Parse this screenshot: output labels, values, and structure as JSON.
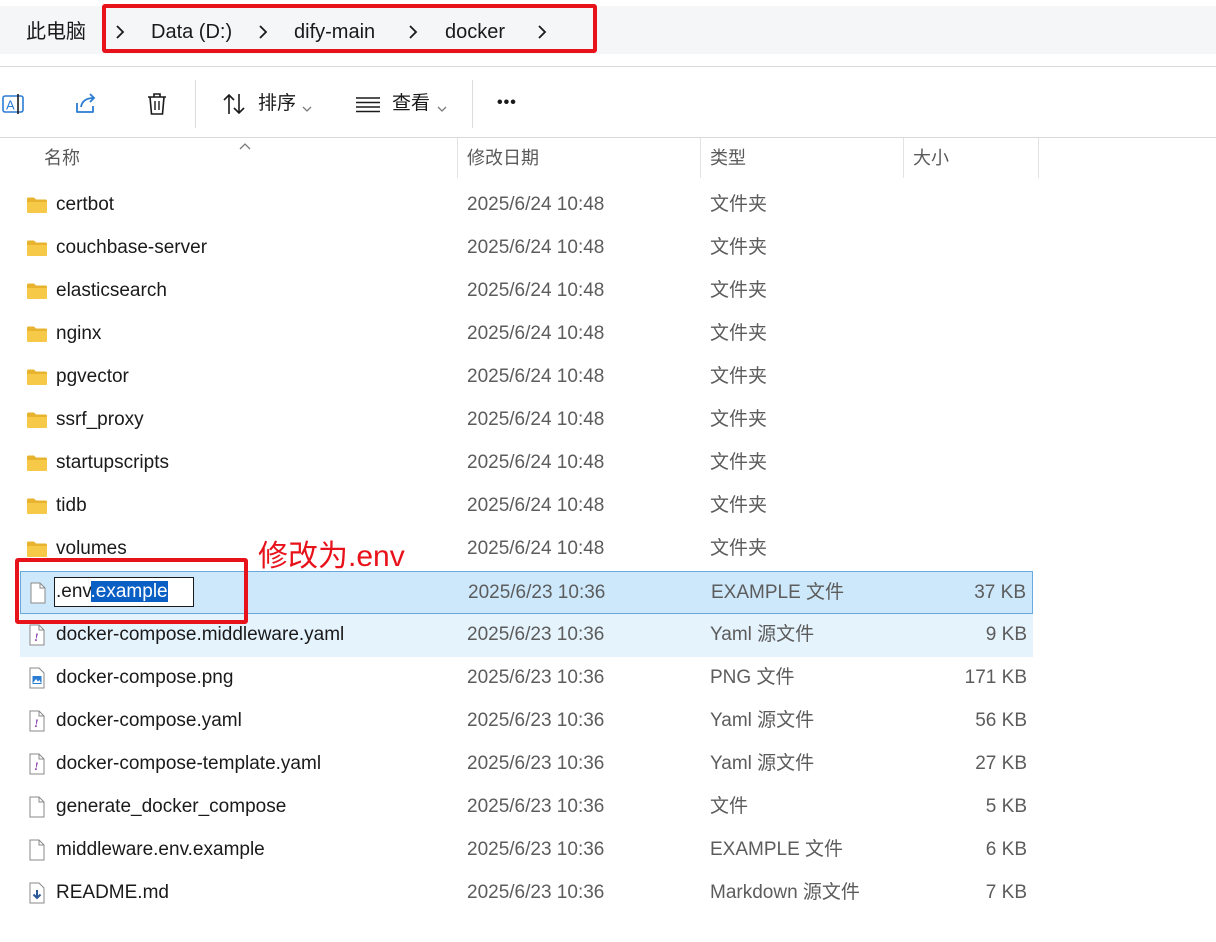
{
  "address": {
    "root": "此电脑",
    "crumbs": [
      "Data (D:)",
      "dify-main",
      "docker"
    ]
  },
  "toolbar": {
    "sort_label": "排序",
    "view_label": "查看",
    "more_label": "•••"
  },
  "columns": {
    "name": "名称",
    "date": "修改日期",
    "type": "类型",
    "size": "大小"
  },
  "files": [
    {
      "name": "certbot",
      "date": "2025/6/24 10:48",
      "type": "文件夹",
      "size": "",
      "icon": "folder-icon"
    },
    {
      "name": "couchbase-server",
      "date": "2025/6/24 10:48",
      "type": "文件夹",
      "size": "",
      "icon": "folder-icon"
    },
    {
      "name": "elasticsearch",
      "date": "2025/6/24 10:48",
      "type": "文件夹",
      "size": "",
      "icon": "folder-icon"
    },
    {
      "name": "nginx",
      "date": "2025/6/24 10:48",
      "type": "文件夹",
      "size": "",
      "icon": "folder-icon"
    },
    {
      "name": "pgvector",
      "date": "2025/6/24 10:48",
      "type": "文件夹",
      "size": "",
      "icon": "folder-icon"
    },
    {
      "name": "ssrf_proxy",
      "date": "2025/6/24 10:48",
      "type": "文件夹",
      "size": "",
      "icon": "folder-icon"
    },
    {
      "name": "startupscripts",
      "date": "2025/6/24 10:48",
      "type": "文件夹",
      "size": "",
      "icon": "folder-icon"
    },
    {
      "name": "tidb",
      "date": "2025/6/24 10:48",
      "type": "文件夹",
      "size": "",
      "icon": "folder-icon"
    },
    {
      "name": "volumes",
      "date": "2025/6/24 10:48",
      "type": "文件夹",
      "size": "",
      "icon": "folder-icon"
    },
    {
      "name": ".env.example",
      "date": "2025/6/23 10:36",
      "type": "EXAMPLE 文件",
      "size": "37 KB",
      "icon": "file-icon"
    },
    {
      "name": "docker-compose.middleware.yaml",
      "date": "2025/6/23 10:36",
      "type": "Yaml 源文件",
      "size": "9 KB",
      "icon": "yaml-file-icon"
    },
    {
      "name": "docker-compose.png",
      "date": "2025/6/23 10:36",
      "type": "PNG 文件",
      "size": "171 KB",
      "icon": "image-file-icon"
    },
    {
      "name": "docker-compose.yaml",
      "date": "2025/6/23 10:36",
      "type": "Yaml 源文件",
      "size": "56 KB",
      "icon": "yaml-file-icon"
    },
    {
      "name": "docker-compose-template.yaml",
      "date": "2025/6/23 10:36",
      "type": "Yaml 源文件",
      "size": "27 KB",
      "icon": "yaml-file-icon"
    },
    {
      "name": "generate_docker_compose",
      "date": "2025/6/23 10:36",
      "type": "文件",
      "size": "5 KB",
      "icon": "file-icon"
    },
    {
      "name": "middleware.env.example",
      "date": "2025/6/23 10:36",
      "type": "EXAMPLE 文件",
      "size": "6 KB",
      "icon": "file-icon"
    },
    {
      "name": "README.md",
      "date": "2025/6/23 10:36",
      "type": "Markdown 源文件",
      "size": "7 KB",
      "icon": "markdown-file-icon"
    }
  ],
  "rename": {
    "prefix": ".env",
    "selected": ".example"
  },
  "annotation": {
    "text": "修改为.env",
    "color": "#e8121b"
  },
  "colors": {
    "selection_bg": "#cde8fb",
    "hover_bg": "#e5f3fd",
    "folder": "#f7c948"
  }
}
